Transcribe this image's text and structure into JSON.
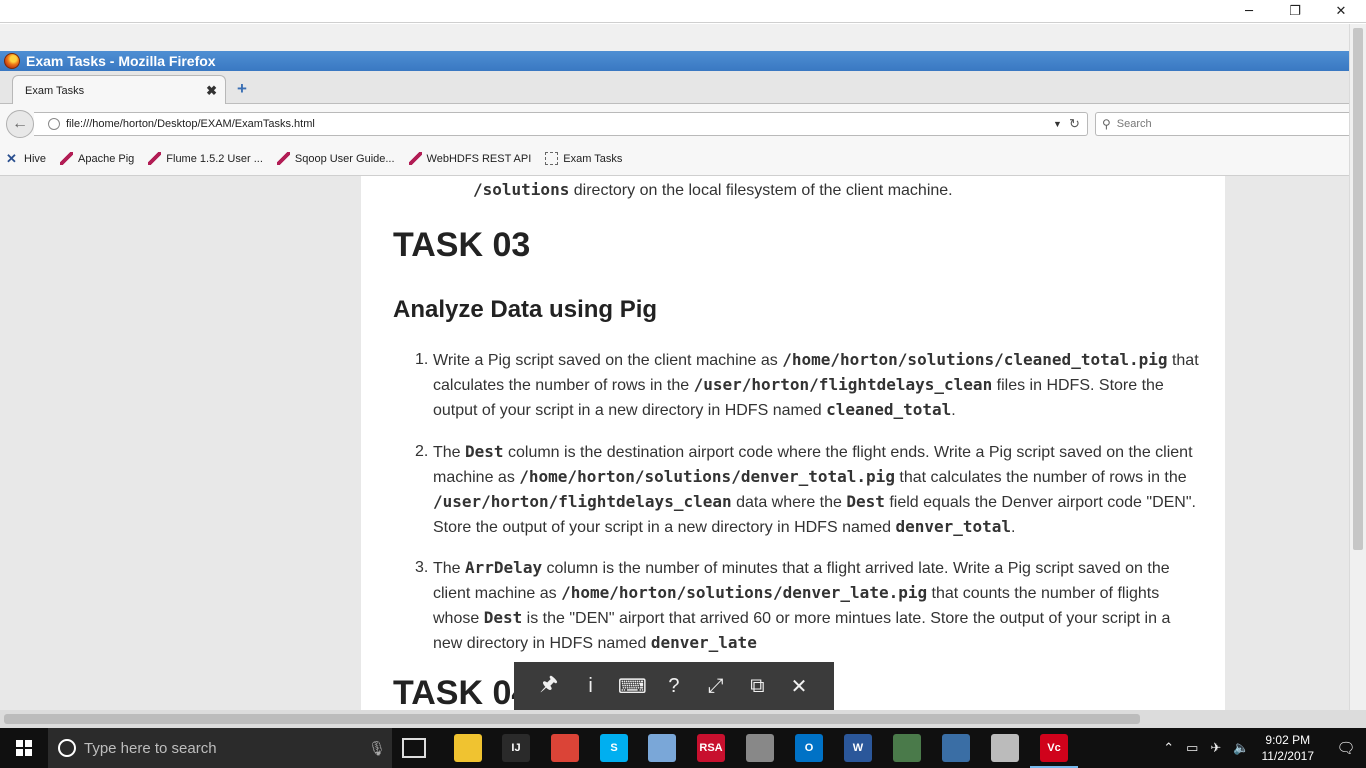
{
  "window": {
    "title": "Exam Tasks - Mozilla Firefox",
    "minimize": "─",
    "restore": "❐",
    "close": "✕"
  },
  "tab": {
    "label": "Exam Tasks",
    "close": "✖",
    "new_tab": "+"
  },
  "nav": {
    "url": "file:///home/horton/Desktop/EXAM/ExamTasks.html",
    "search_placeholder": "Search"
  },
  "bookmarks": [
    {
      "label": "Hive",
      "icon": "hive-icon"
    },
    {
      "label": "Apache Pig",
      "icon": "pig-icon"
    },
    {
      "label": "Flume 1.5.2 User ...",
      "icon": "flume-icon"
    },
    {
      "label": "Sqoop User Guide...",
      "icon": "sqoop-icon"
    },
    {
      "label": "WebHDFS REST API",
      "icon": "webhdfs-icon"
    },
    {
      "label": "Exam Tasks",
      "icon": "page-icon"
    }
  ],
  "page": {
    "top_line_code": "/solutions",
    "top_line_text": " directory on the local filesystem of the client machine.",
    "task03": "TASK 03",
    "subheading": "Analyze Data using Pig",
    "items": [
      {
        "num": "1.",
        "parts": [
          {
            "t": "Write a Pig script saved on the client machine as "
          },
          {
            "c": "/home/horton/solutions/cleaned_total.pig"
          },
          {
            "t": " that calculates the number of rows in the "
          },
          {
            "c": "/user/horton/flightdelays_clean"
          },
          {
            "t": " files in HDFS. Store the output of your script in a new directory in HDFS named "
          },
          {
            "c": "cleaned_total"
          },
          {
            "t": "."
          }
        ]
      },
      {
        "num": "2.",
        "parts": [
          {
            "t": "The "
          },
          {
            "c": "Dest"
          },
          {
            "t": " column is the destination airport code where the flight ends. Write a Pig script saved on the client machine as "
          },
          {
            "c": "/home/horton/solutions/denver_total.pig"
          },
          {
            "t": " that calculates the number of rows in the "
          },
          {
            "c": "/user/horton/flightdelays_clean"
          },
          {
            "t": " data where the "
          },
          {
            "c": "Dest"
          },
          {
            "t": " field equals the Denver airport code \"DEN\". Store the output of your script in a new directory in HDFS named "
          },
          {
            "c": "denver_total"
          },
          {
            "t": "."
          }
        ]
      },
      {
        "num": "3.",
        "parts": [
          {
            "t": "The "
          },
          {
            "c": "ArrDelay"
          },
          {
            "t": " column is the number of minutes that a flight arrived late. Write a Pig script saved on the client machine as "
          },
          {
            "c": "/home/horton/solutions/denver_late.pig"
          },
          {
            "t": " that counts the number of flights whose "
          },
          {
            "c": "Dest"
          },
          {
            "t": " is the \"DEN\" airport that arrived 60 or more mintues late. Store the output of your script in a new directory in HDFS named "
          },
          {
            "c": "denver_late"
          }
        ]
      }
    ],
    "task04": "TASK 04"
  },
  "remote_toolbar": {
    "pin": "🖈",
    "info": "i",
    "keyboard": "⌨",
    "help": "?",
    "fullscreen": "⤢",
    "fit": "⧉",
    "close": "✕"
  },
  "taskbar": {
    "search_placeholder": "Type here to search",
    "time": "9:02 PM",
    "date": "11/2/2017",
    "apps": [
      {
        "name": "file-explorer-icon",
        "label": "",
        "bg": "#f0c330"
      },
      {
        "name": "intellij-icon",
        "label": "IJ",
        "bg": "#2a2a2a"
      },
      {
        "name": "chrome-icon",
        "label": "",
        "bg": "#db4437"
      },
      {
        "name": "skype-icon",
        "label": "S",
        "bg": "#00aff0"
      },
      {
        "name": "paint-icon",
        "label": "",
        "bg": "#7aa7d8"
      },
      {
        "name": "rsa-icon",
        "label": "RSA",
        "bg": "#c8102e"
      },
      {
        "name": "app-circle-icon",
        "label": "",
        "bg": "#888888"
      },
      {
        "name": "outlook-icon",
        "label": "O",
        "bg": "#0072c6"
      },
      {
        "name": "word-icon",
        "label": "W",
        "bg": "#2b579a"
      },
      {
        "name": "terminal-icon",
        "label": "",
        "bg": "#4a7a4a"
      },
      {
        "name": "network-icon",
        "label": "",
        "bg": "#3a6ea5"
      },
      {
        "name": "printer-icon",
        "label": "",
        "bg": "#bbbbbb"
      },
      {
        "name": "vc-icon",
        "label": "Vc",
        "bg": "#d0021b"
      }
    ]
  }
}
